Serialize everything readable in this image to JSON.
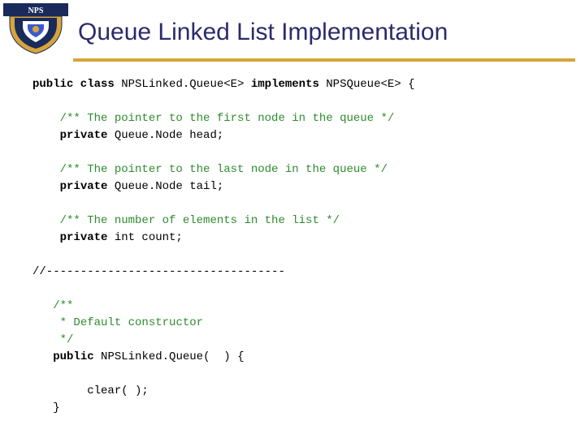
{
  "title": "Queue Linked List Implementation",
  "code": {
    "kw1": "public class",
    "cls": " NPSLinked.Queue<E> ",
    "kw2": "implements",
    "iface": " NPSQueue<E> {",
    "c1": "/** The pointer to the first node in the queue */",
    "kw3": "private",
    "f1": " Queue.Node head;",
    "c2": "/** The pointer to the last node in the queue */",
    "kw4": "private",
    "f2": " Queue.Node tail;",
    "c3": "/** The number of elements in the list */",
    "kw5": "private",
    "f3": " int count;",
    "sep": "//-----------------------------------",
    "c4a": "/**",
    "c4b": " * Default constructor",
    "c4c": " */",
    "kw6": "public",
    "ctor": " NPSLinked.Queue(  ) {",
    "body": "clear( );",
    "close": "}"
  }
}
